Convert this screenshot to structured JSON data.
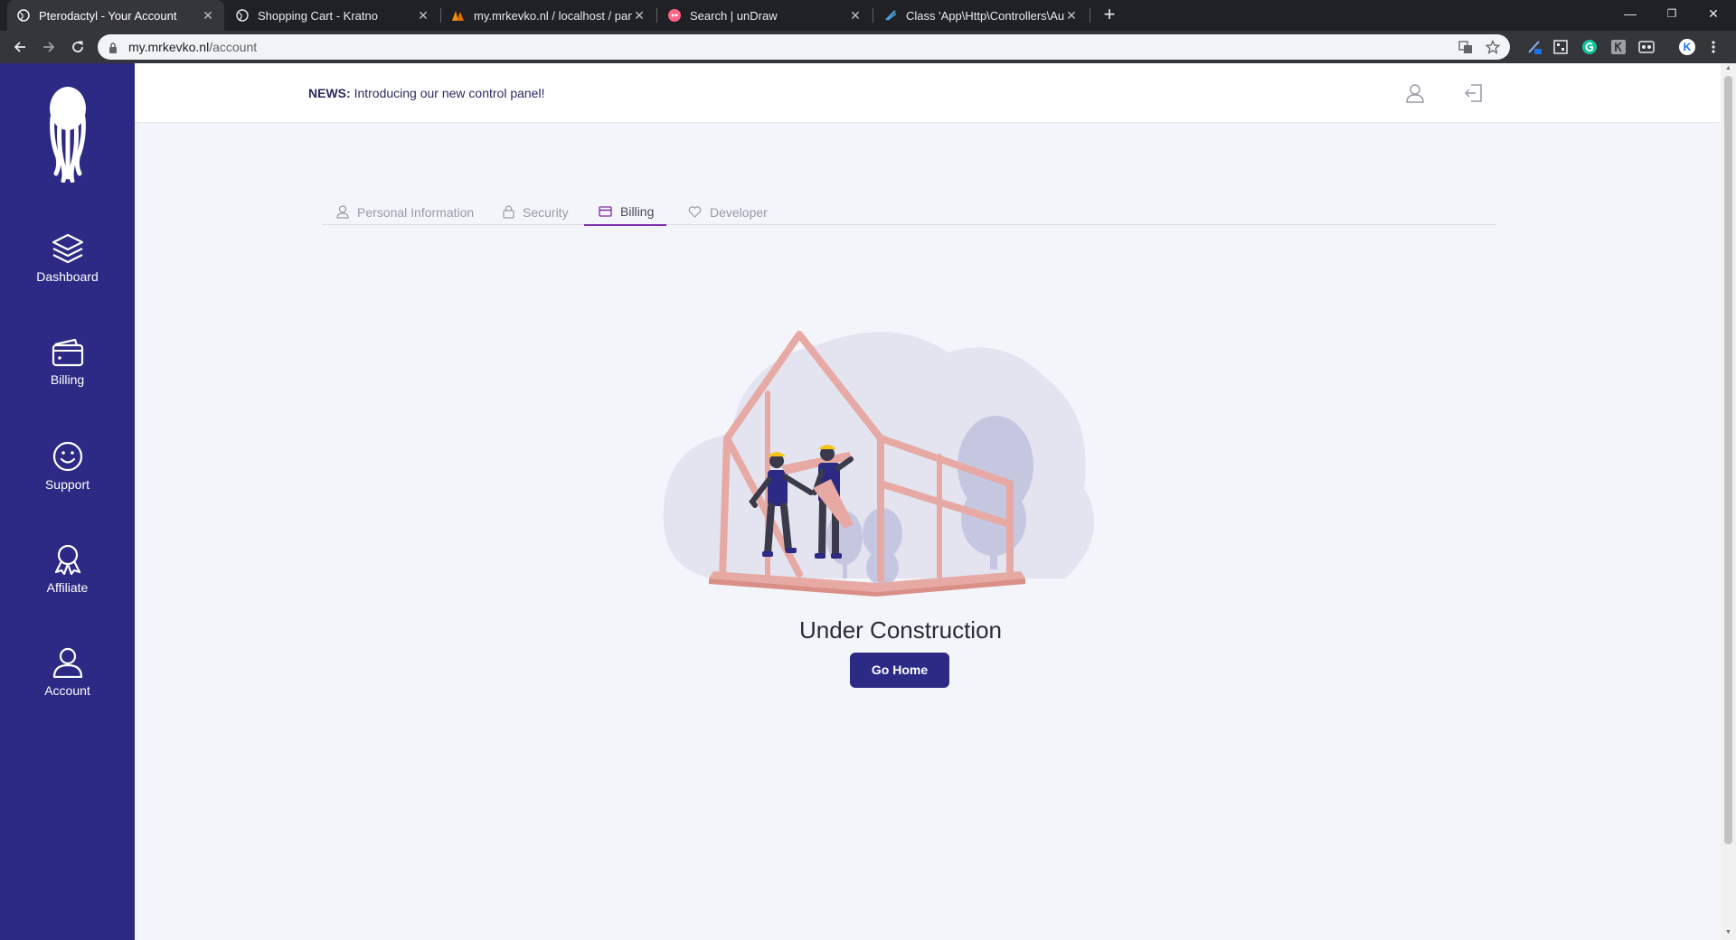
{
  "browser": {
    "tabs": [
      {
        "title": "Pterodactyl - Your Account",
        "active": true
      },
      {
        "title": "Shopping Cart - Kratno",
        "active": false
      },
      {
        "title": "my.mrkevko.nl / localhost / pane",
        "active": false
      },
      {
        "title": "Search | unDraw",
        "active": false
      },
      {
        "title": "Class 'App\\Http\\Controllers\\Auth",
        "active": false
      }
    ],
    "close_glyph": "✕",
    "new_tab_glyph": "+",
    "url_host": "my.mrkevko.nl",
    "url_path": "/account",
    "profile_initial": "K",
    "window_controls": {
      "minimize": "—",
      "restore": "❐",
      "close": "✕"
    }
  },
  "sidebar": {
    "items": [
      {
        "label": "Dashboard",
        "icon": "layers-icon"
      },
      {
        "label": "Billing",
        "icon": "wallet-icon"
      },
      {
        "label": "Support",
        "icon": "smiley-icon"
      },
      {
        "label": "Affiliate",
        "icon": "award-icon"
      },
      {
        "label": "Account",
        "icon": "user-icon"
      }
    ]
  },
  "header": {
    "news_label": "NEWS:",
    "news_text": "Introducing our new control panel!"
  },
  "account_tabs": [
    {
      "label": "Personal Information",
      "icon": "user-icon",
      "active": false
    },
    {
      "label": "Security",
      "icon": "lock-icon",
      "active": false
    },
    {
      "label": "Billing",
      "icon": "credit-card-icon",
      "active": true
    },
    {
      "label": "Developer",
      "icon": "heart-icon",
      "active": false
    }
  ],
  "content": {
    "heading": "Under Construction",
    "button_label": "Go Home"
  },
  "colors": {
    "sidebar": "#2c2a84",
    "accent": "#7b2fa8",
    "background": "#f4f5fa"
  }
}
